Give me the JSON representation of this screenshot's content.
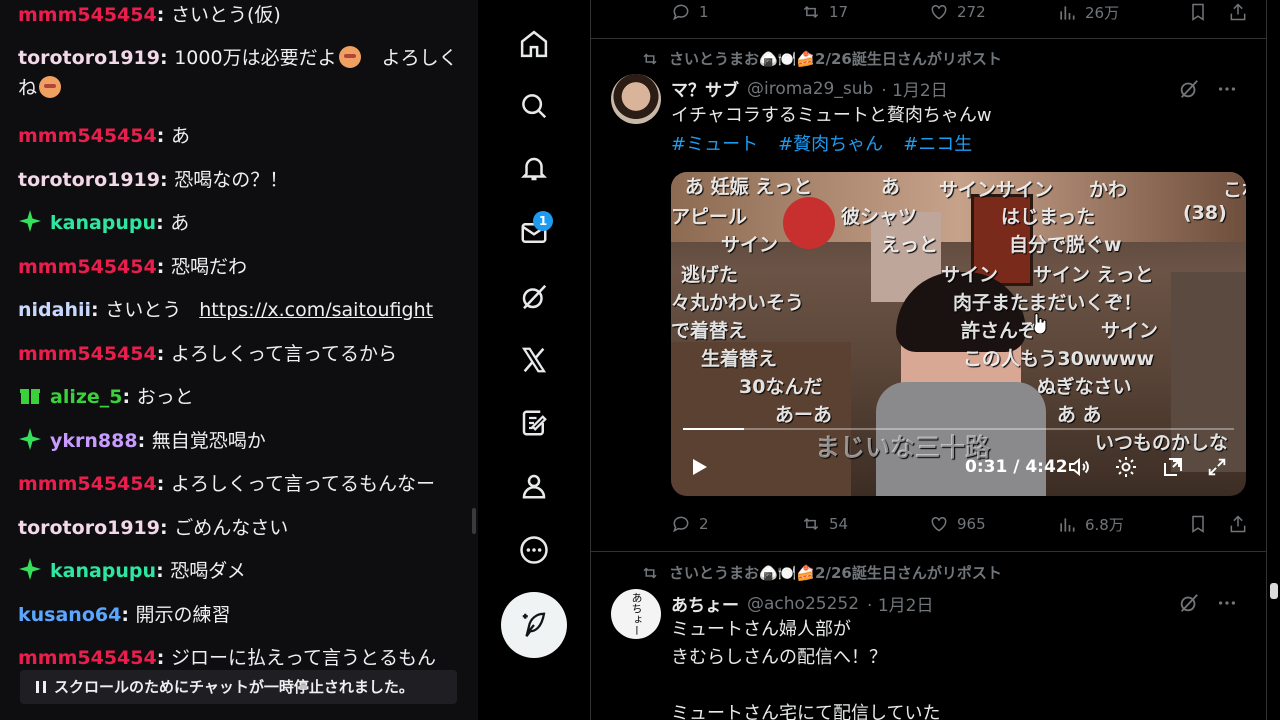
{
  "chat": {
    "messages": [
      {
        "user": "mmm545454",
        "color": "#e91e4d",
        "text": "さいとう(仮)",
        "badge": ""
      },
      {
        "user": "torotoro1919",
        "color": "#f3d8e8",
        "text": "1000万は必要だよ",
        "text2": "　よろし",
        "text3": "くね",
        "badge": ""
      },
      {
        "user": "mmm545454",
        "color": "#e91e4d",
        "text": "あ",
        "badge": ""
      },
      {
        "user": "torotoro1919",
        "color": "#f3d8e8",
        "text": "恐喝なの？！",
        "badge": ""
      },
      {
        "user": "kanapupu",
        "color": "#2ee6a0",
        "text": "あ",
        "badge": "sparkle"
      },
      {
        "user": "mmm545454",
        "color": "#e91e4d",
        "text": "恐喝だわ",
        "badge": ""
      },
      {
        "user": "nidahii",
        "color": "#c9d8ff",
        "text": "さいとう",
        "link": "https://x.com/saitoufight",
        "badge": ""
      },
      {
        "user": "mmm545454",
        "color": "#e91e4d",
        "text": "よろしくって言ってるから",
        "badge": ""
      },
      {
        "user": "alize_5",
        "color": "#3ad13a",
        "text": "おっと",
        "badge": "gift"
      },
      {
        "user": "ykrn888",
        "color": "#c89cff",
        "text": "無自覚恐喝か",
        "badge": "sparkle"
      },
      {
        "user": "mmm545454",
        "color": "#e91e4d",
        "text": "よろしくって言ってるもんなー",
        "badge": ""
      },
      {
        "user": "torotoro1919",
        "color": "#f3d8e8",
        "text": "ごめんなさい",
        "badge": ""
      },
      {
        "user": "kanapupu",
        "color": "#2ee6a0",
        "text": "恐喝ダメ",
        "badge": "sparkle"
      },
      {
        "user": "kusano64",
        "color": "#5ba7ff",
        "text": "開示の練習",
        "badge": ""
      },
      {
        "user": "mmm545454",
        "color": "#e91e4d",
        "text": "ジローに払えって言うとるもん",
        "badge": ""
      }
    ],
    "paused_notice": "スクロールのためにチャットが一時停止されました。"
  },
  "nav": {
    "notification_count": "1",
    "items": [
      "home-icon",
      "search-icon",
      "bell-icon",
      "mail-icon",
      "grok-icon",
      "x-logo-icon",
      "lists-icon",
      "profile-icon",
      "more-icon"
    ]
  },
  "timeline": {
    "prev_tweet_actions": {
      "replies": "1",
      "reposts": "17",
      "likes": "272",
      "views": "26万"
    },
    "tweets": [
      {
        "repost_by": "さいとうまお🍙🍽️🍰2/26誕生日さんがリポスト",
        "name": "マ？サブ",
        "handle": "@iroma29_sub",
        "date": "· 1月2日",
        "text": "イチャコラするミュートと贅肉ちゃんw",
        "hashtags": [
          "#ミュート",
          "#贅肉ちゃん",
          "#ニコ生"
        ],
        "video": {
          "time": "0:31 / 4:42",
          "progress": 0.11,
          "comments": [
            "あ 妊娠 えっと",
            "あ",
            "サインサイン",
            "かわ",
            "これ",
            "アピール",
            "彼シャツ",
            "はじまった",
            "(38)",
            "サイン",
            "えっと",
            "自分で脱ぐw",
            "逃げた",
            "サイン",
            "サイン えっと",
            "々丸かわいそう",
            "肉子またまだいくぞ！",
            "で着替え",
            "許さんぞ",
            "サイン",
            "生着替え",
            "この人もう30wwww",
            "30なんだ",
            "ぬぎなさい",
            "あーあ",
            "あ あ",
            "まじいな三十路",
            "いつものかしな"
          ]
        },
        "actions": {
          "replies": "2",
          "reposts": "54",
          "likes": "965",
          "views": "6.8万"
        }
      },
      {
        "repost_by": "さいとうまお🍙🍽️🍰2/26誕生日さんがリポスト",
        "name": "あちょー",
        "handle": "@acho25252",
        "date": "· 1月2日",
        "text_lines": [
          "ミュートさん婦人部が",
          "きむらしさんの配信へ！？",
          "",
          "ミュートさん宅にて配信していた"
        ],
        "avatar_text": "あちょー"
      }
    ]
  },
  "colors": {
    "accent": "#1d9bf0",
    "muted": "#71767b",
    "text": "#e7e9ea"
  }
}
